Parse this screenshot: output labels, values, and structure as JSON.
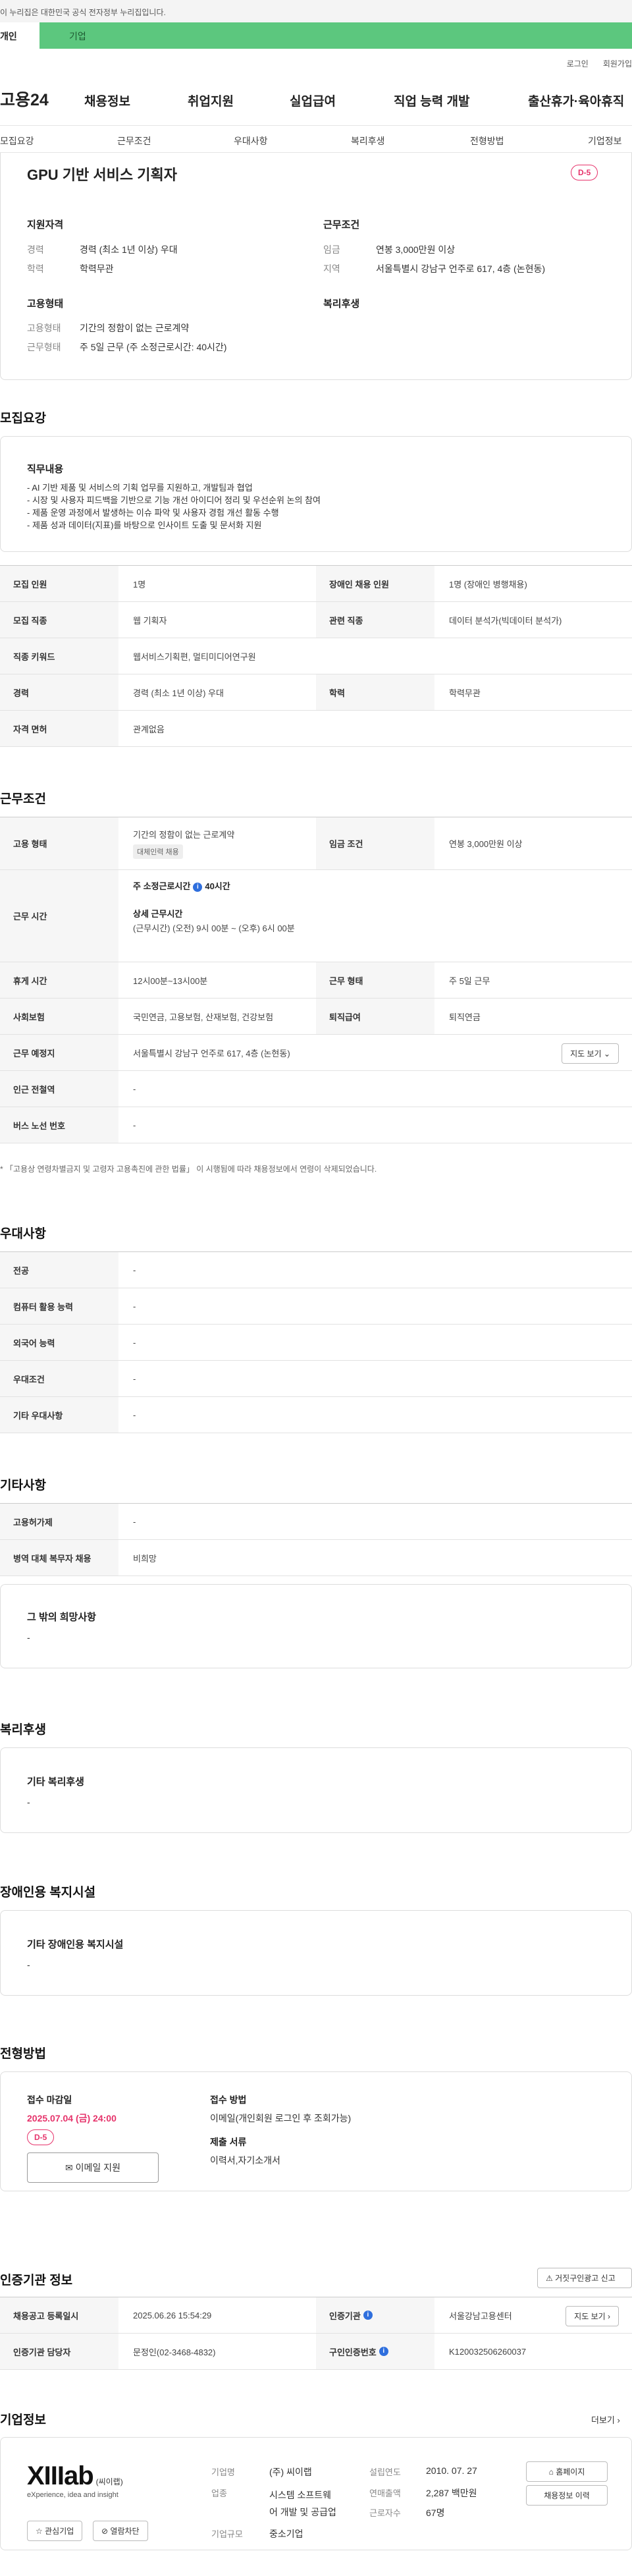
{
  "gov_bar": "이 누리집은 대한민국 공식 전자정부 누리집입니다.",
  "tabs": {
    "individual": "개인",
    "corp": "기업"
  },
  "util": {
    "login": "로그인",
    "signup": "회원가입"
  },
  "logo": "고용24",
  "gnb": [
    "채용정보",
    "취업지원",
    "실업급여",
    "직업 능력 개발",
    "출산휴가·육아휴직"
  ],
  "subnav": [
    "모집요강",
    "근무조건",
    "우대사항",
    "복리후생",
    "전형방법",
    "기업정보"
  ],
  "summary": {
    "title": "GPU 기반 서비스 기획자",
    "dday": "D-5",
    "qual_head": "지원자격",
    "qual": [
      {
        "k": "경력",
        "v": "경력 (최소 1년 이상) 우대"
      },
      {
        "k": "학력",
        "v": "학력무관"
      }
    ],
    "work_head": "근무조건",
    "work": [
      {
        "k": "임금",
        "v": "연봉 3,000만원 이상"
      },
      {
        "k": "지역",
        "v": "서울특별시 강남구 언주로 617, 4층 (논현동)"
      }
    ],
    "emp_head": "고용형태",
    "emp": [
      {
        "k": "고용형태",
        "v": "기간의 정함이 없는 근로계약"
      },
      {
        "k": "근무형태",
        "v": "주 5일 근무 (주 소정근로시간: 40시간)"
      }
    ],
    "welfare_head": "복리후생"
  },
  "recruit": {
    "title": "모집요강",
    "duty_head": "직무내용",
    "duties": [
      "- AI 기반 제품 및 서비스의 기획 업무를 지원하고, 개발팀과 협업",
      "- 시장 및 사용자 피드백을 기반으로 기능 개선 아이디어 정리 및 우선순위 논의 참여",
      "- 제품 운영 과정에서 발생하는 이슈 파악 및 사용자 경험 개선 활동 수행",
      "- 제품 성과 데이터(지표)를 바탕으로 인사이트 도출 및 문서화 지원"
    ],
    "rows": [
      [
        {
          "k": "모집 인원",
          "v": "1명"
        },
        {
          "k": "장애인 채용 인원",
          "v": "1명 (장애인 병행채용)"
        }
      ],
      [
        {
          "k": "모집 직종",
          "v": "웹 기획자"
        },
        {
          "k": "관련 직종",
          "v": "데이터 분석가(빅데이터 분석가)"
        }
      ],
      [
        {
          "k": "직종 키워드",
          "v": "웹서비스기획편, 멀티미디어연구원"
        }
      ],
      [
        {
          "k": "경력",
          "v": "경력 (최소 1년 이상) 우대"
        },
        {
          "k": "학력",
          "v": "학력무관"
        }
      ],
      [
        {
          "k": "자격 면허",
          "v": "관계없음"
        }
      ]
    ]
  },
  "work": {
    "title": "근무조건",
    "emp_k": "고용 형태",
    "emp_v": "기간의 정함이 없는 근로계약",
    "emp_badge": "대체인력 채용",
    "wage_k": "임금 조건",
    "wage_v": "연봉 3,000만원 이상",
    "hours_k": "근무 시간",
    "hours_v1": "주 소정근로시간",
    "hours_v1b": "40시간",
    "hours_v2": "상세 근무시간",
    "hours_v3": "(근무시간) (오전) 9시 00분 ~ (오후) 6시 00분",
    "break_k": "휴게 시간",
    "break_v": "12시00분~13시00분",
    "form_k": "근무 형태",
    "form_v": "주 5일 근무",
    "ins_k": "사회보험",
    "ins_v": "국민연금, 고용보험, 산재보험, 건강보험",
    "ret_k": "퇴직급여",
    "ret_v": "퇴직연금",
    "place_k": "근무 예정지",
    "place_v": "서울특별시 강남구 언주로 617, 4층 (논현동)",
    "map_btn": "지도 보기",
    "subway_k": "인근 전철역",
    "subway_v": "-",
    "bus_k": "버스 노선 번호",
    "bus_v": "-",
    "note": "* 「고용상 연령차별금지 및 고령자 고용촉진에 관한 법률」 이 시행됨에 따라 채용정보에서 연령이 삭제되었습니다."
  },
  "pref": {
    "title": "우대사항",
    "rows": [
      {
        "k": "전공",
        "v": "-"
      },
      {
        "k": "컴퓨터 활용 능력",
        "v": "-"
      },
      {
        "k": "외국어 능력",
        "v": "-"
      },
      {
        "k": "우대조건",
        "v": "-"
      },
      {
        "k": "기타 우대사항",
        "v": "-"
      }
    ]
  },
  "etc": {
    "title": "기타사항",
    "rows": [
      {
        "k": "고용허가제",
        "v": "-"
      },
      {
        "k": "병역 대체 복무자 채용",
        "v": "비희망"
      }
    ],
    "wish_head": "그 밖의 희망사항",
    "wish_v": "-"
  },
  "welfare": {
    "title": "복리후생",
    "head": "기타 복리후생",
    "v": "-"
  },
  "disabled": {
    "title": "장애인용 복지시설",
    "head": "기타 장애인용 복지시설",
    "v": "-"
  },
  "screening": {
    "title": "전형방법",
    "deadline_k": "접수 마감일",
    "deadline_v": "2025.07.04 (금) 24:00",
    "dday": "D-5",
    "email_btn": "이메일 지원",
    "method_k": "접수 방법",
    "method_v": "이메일(개인회원 로그인 후 조회가능)",
    "docs_k": "제출 서류",
    "docs_v": "이력서,자기소개서"
  },
  "cert": {
    "title": "인증기관 정보",
    "report_btn": "거짓구인광고 신고",
    "reg_k": "채용공고 등록일시",
    "reg_v": "2025.06.26 15:54:29",
    "agency_k": "인증기관",
    "agency_v": "서울강남고용센터",
    "map_btn": "지도 보기",
    "staff_k": "인증기관 담당자",
    "staff_v": "문정인(02-3468-4832)",
    "num_k": "구인인증번호",
    "num_v": "K120032506260037"
  },
  "company": {
    "title": "기업정보",
    "more": "더보기",
    "logo_main": "XIIIab",
    "logo_sub": "(씨이랩)",
    "logo_tag": "eXperience, idea and insight",
    "fav_btn": "관심기업",
    "block_btn": "열람차단",
    "name_k": "기업명",
    "name_v": "(주) 씨이랩",
    "biz_k": "업종",
    "biz_v1": "시스템 소프트웨",
    "biz_v2": "어 개발 및 공급업",
    "size_k": "기업규모",
    "size_v": "중소기업",
    "est_k": "설립연도",
    "est_v": "2010. 07. 27",
    "sales_k": "연매출액",
    "sales_v": "2,287 백만원",
    "emp_k": "근로자수",
    "emp_v": "67명",
    "home_btn": "홈페이지",
    "jobs_btn": "채용정보 이력"
  },
  "colors": {
    "accent": "#5cc77e",
    "dday": "#e6336b",
    "info": "#2f6fdd"
  }
}
